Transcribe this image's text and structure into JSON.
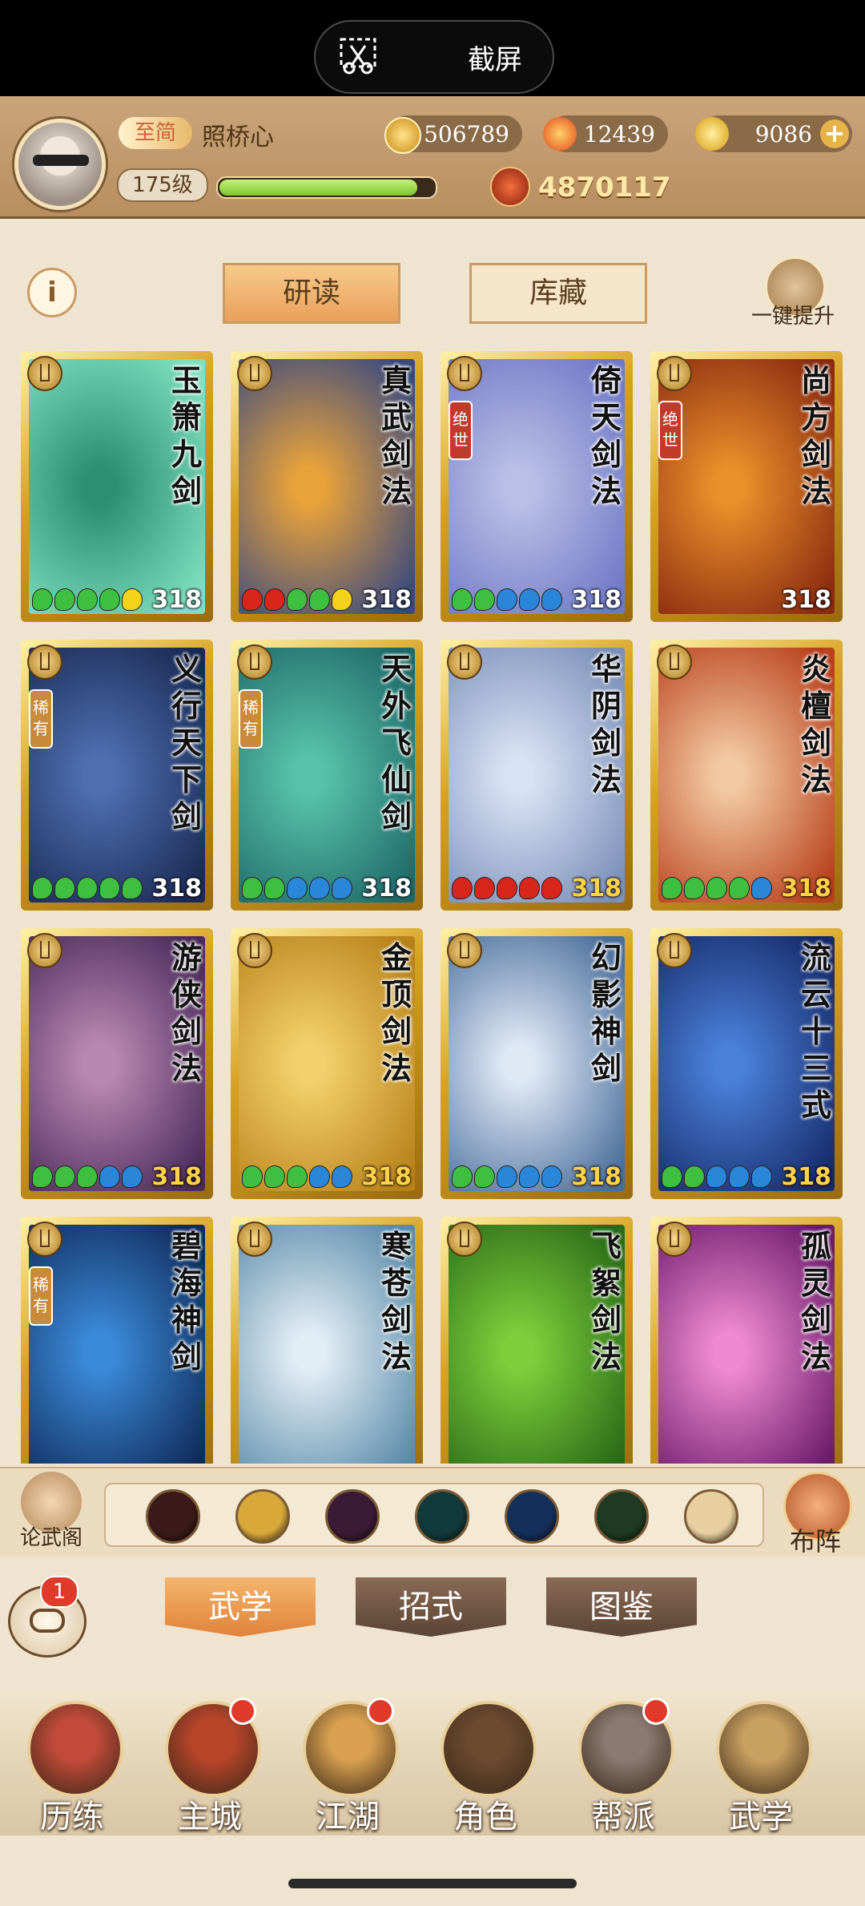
{
  "system_bar": {
    "screenshot_label": "截屏"
  },
  "header": {
    "vip": "至简",
    "username": "照桥心",
    "coins": "506789",
    "fire": "12439",
    "gold": "9086",
    "level": "175级",
    "exp_progress": 0.92,
    "power": "4870117"
  },
  "tabs": {
    "study": "研读",
    "collection": "库藏",
    "upgrade_all": "一键提升"
  },
  "cards": [
    {
      "name": "玉箫九剑",
      "level": "318",
      "rarity": "",
      "stars": [
        "g",
        "g",
        "g",
        "g",
        "y"
      ],
      "art": [
        "#2c8f6f",
        "#7fe0c0"
      ]
    },
    {
      "name": "真武剑法",
      "level": "318",
      "rarity": "",
      "stars": [
        "r",
        "r",
        "g",
        "g",
        "y"
      ],
      "art": [
        "#e9a23a",
        "#3a4a80"
      ]
    },
    {
      "name": "倚天剑法",
      "level": "318",
      "rarity": "绝世",
      "stars": [
        "g",
        "g",
        "b",
        "b",
        "b"
      ],
      "art": [
        "#b9bfe6",
        "#6f78c6"
      ]
    },
    {
      "name": "尚方剑法",
      "level": "318",
      "rarity": "绝世",
      "stars": [],
      "art": [
        "#e8902a",
        "#8a2a10"
      ]
    },
    {
      "name": "义行天下剑",
      "level": "318",
      "rarity": "稀有",
      "stars": [
        "g",
        "g",
        "g",
        "g",
        "g"
      ],
      "art": [
        "#4f6fb0",
        "#1a2a55"
      ]
    },
    {
      "name": "天外飞仙剑",
      "level": "318",
      "rarity": "稀有",
      "stars": [
        "g",
        "g",
        "b",
        "b",
        "b"
      ],
      "art": [
        "#58c2a8",
        "#1e6a6a"
      ]
    },
    {
      "name": "华阴剑法",
      "level": "318",
      "rarity": "",
      "stars": [
        "r",
        "r",
        "r",
        "r",
        "r"
      ],
      "art": [
        "#d7e2f4",
        "#7b8fb8"
      ],
      "gold": true
    },
    {
      "name": "炎檀剑法",
      "level": "318",
      "rarity": "",
      "stars": [
        "g",
        "g",
        "g",
        "g",
        "b"
      ],
      "art": [
        "#f2c8a0",
        "#b8401c"
      ],
      "gold": true
    },
    {
      "name": "游侠剑法",
      "level": "318",
      "rarity": "",
      "stars": [
        "g",
        "g",
        "g",
        "b",
        "b"
      ],
      "art": [
        "#b888b2",
        "#4a2a5a"
      ],
      "gold": true
    },
    {
      "name": "金顶剑法",
      "level": "318",
      "rarity": "",
      "stars": [
        "g",
        "g",
        "g",
        "b",
        "b"
      ],
      "art": [
        "#f4d06a",
        "#b8821a"
      ],
      "gold": true
    },
    {
      "name": "幻影神剑",
      "level": "318",
      "rarity": "",
      "stars": [
        "g",
        "g",
        "b",
        "b",
        "b"
      ],
      "art": [
        "#dfe9f6",
        "#4a6e9a"
      ],
      "gold": true
    },
    {
      "name": "流云十三式",
      "level": "318",
      "rarity": "",
      "stars": [
        "g",
        "g",
        "b",
        "b",
        "b"
      ],
      "art": [
        "#4a80d8",
        "#162a6a"
      ],
      "gold": true
    },
    {
      "name": "碧海神剑",
      "level": "",
      "rarity": "稀有",
      "stars": [],
      "art": [
        "#3a8ad8",
        "#102a5a"
      ]
    },
    {
      "name": "寒苍剑法",
      "level": "",
      "rarity": "",
      "stars": [],
      "art": [
        "#e2eef6",
        "#5a8aa8"
      ]
    },
    {
      "name": "飞絮剑法",
      "level": "",
      "rarity": "",
      "stars": [],
      "art": [
        "#7ccf3a",
        "#2a6a18"
      ]
    },
    {
      "name": "孤灵剑法",
      "level": "",
      "rarity": "",
      "stars": [],
      "art": [
        "#f08ad0",
        "#6a1a6a"
      ]
    }
  ],
  "filter_bar": {
    "left_label": "论武阁",
    "right_label": "布阵",
    "filters": [
      {
        "icon": "sword-filter-icon",
        "color": "#3a1a1a"
      },
      {
        "icon": "emblem-filter-icon",
        "color": "#d8a83a"
      },
      {
        "icon": "feather-filter-icon",
        "color": "#3a1a34"
      },
      {
        "icon": "fan-filter-icon",
        "color": "#123a3a"
      },
      {
        "icon": "yinyang-filter-icon",
        "color": "#14305a"
      },
      {
        "icon": "swirl-filter-icon",
        "color": "#1e3a22"
      },
      {
        "icon": "rank-up-filter-icon",
        "color": "#e8cfa0"
      }
    ]
  },
  "chat": {
    "badge": "1"
  },
  "subtabs": {
    "martial": "武学",
    "moves": "招式",
    "atlas": "图鉴"
  },
  "nav": [
    {
      "label": "历练",
      "dot": false,
      "color": "#c24a3a"
    },
    {
      "label": "主城",
      "dot": true,
      "color": "#b8452a"
    },
    {
      "label": "江湖",
      "dot": true,
      "color": "#d8a050"
    },
    {
      "label": "角色",
      "dot": false,
      "color": "#6a4a30"
    },
    {
      "label": "帮派",
      "dot": true,
      "color": "#8a7a70"
    },
    {
      "label": "武学",
      "dot": false,
      "color": "#c8a060"
    }
  ],
  "colors": {
    "star_g": "#3fbf3f",
    "star_y": "#f5d21a",
    "star_r": "#d8261c",
    "star_b": "#2a86d8"
  }
}
